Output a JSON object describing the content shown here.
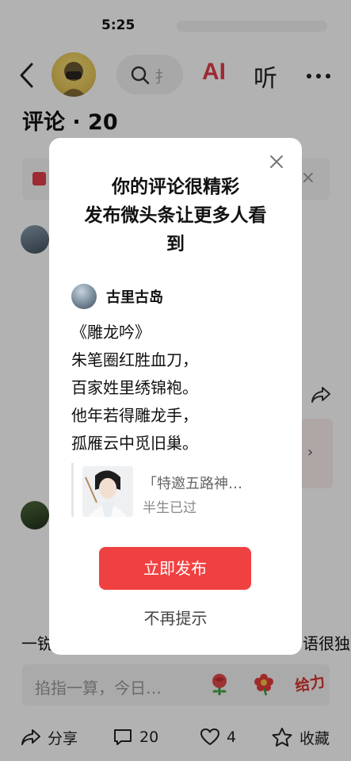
{
  "status_bar": {
    "time": "5:25"
  },
  "header": {
    "ai_label": "AI",
    "listen_label": "听",
    "search_partial": "扌"
  },
  "comments": {
    "title": "评论 · 20"
  },
  "background": {
    "text_left": "一锐",
    "text_right": "语很独特"
  },
  "input_bar": {
    "placeholder": "掐指一算，今日…"
  },
  "emoji3_label": "给力",
  "bottom_bar": {
    "share": "分享",
    "comments": "20",
    "likes": "4",
    "favorite": "收藏"
  },
  "modal": {
    "title_lines": [
      "你的评论很精彩",
      "发布微头条让更多人看",
      "到"
    ],
    "author": "古里古岛",
    "poem": [
      "《雕龙吟》",
      "朱笔圈红胜血刀，",
      "百家姓里绣锦袍。",
      "他年若得雕龙手，",
      "孤雁云中觅旧巢。"
    ],
    "quote_title": "「特邀五路神…",
    "quote_sub": "半生已过",
    "publish": "立即发布",
    "no_remind": "不再提示"
  },
  "colors": {
    "accent": "#f04142",
    "ai": "#e33d4a",
    "overlay": "rgba(0,0,0,0.30)"
  },
  "icons": [
    "back-icon",
    "search-icon",
    "more-icon",
    "close-icon",
    "share-icon",
    "comment-icon",
    "heart-icon",
    "star-icon"
  ]
}
